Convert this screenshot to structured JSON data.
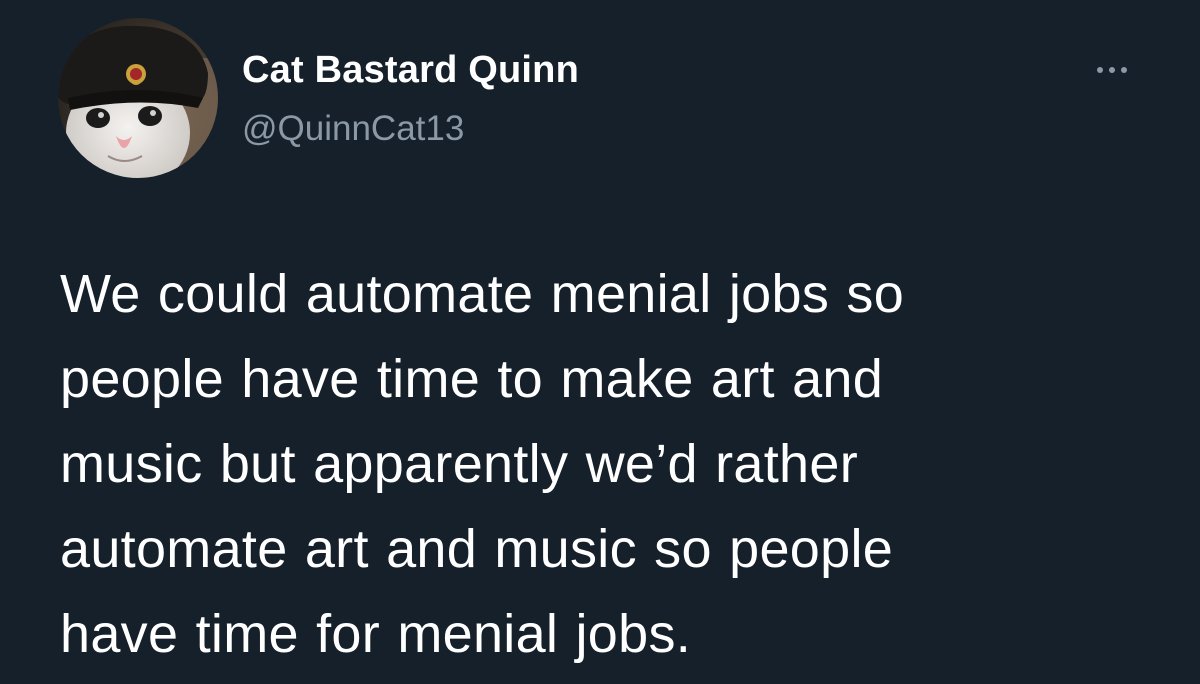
{
  "theme": {
    "background": "#15202b",
    "text_primary": "#ffffff",
    "text_secondary": "#8b98a5"
  },
  "author": {
    "display_name": "Cat Bastard Quinn",
    "handle": "@QuinnCat13",
    "avatar": "cat-in-ushanka-photo"
  },
  "header": {
    "more_icon": "more-horizontal-icon"
  },
  "tweet": {
    "lines": [
      "We could automate menial jobs so",
      "people have time to make art and",
      "music but apparently we’d rather",
      "automate art and music so people",
      "have time for menial jobs."
    ]
  }
}
